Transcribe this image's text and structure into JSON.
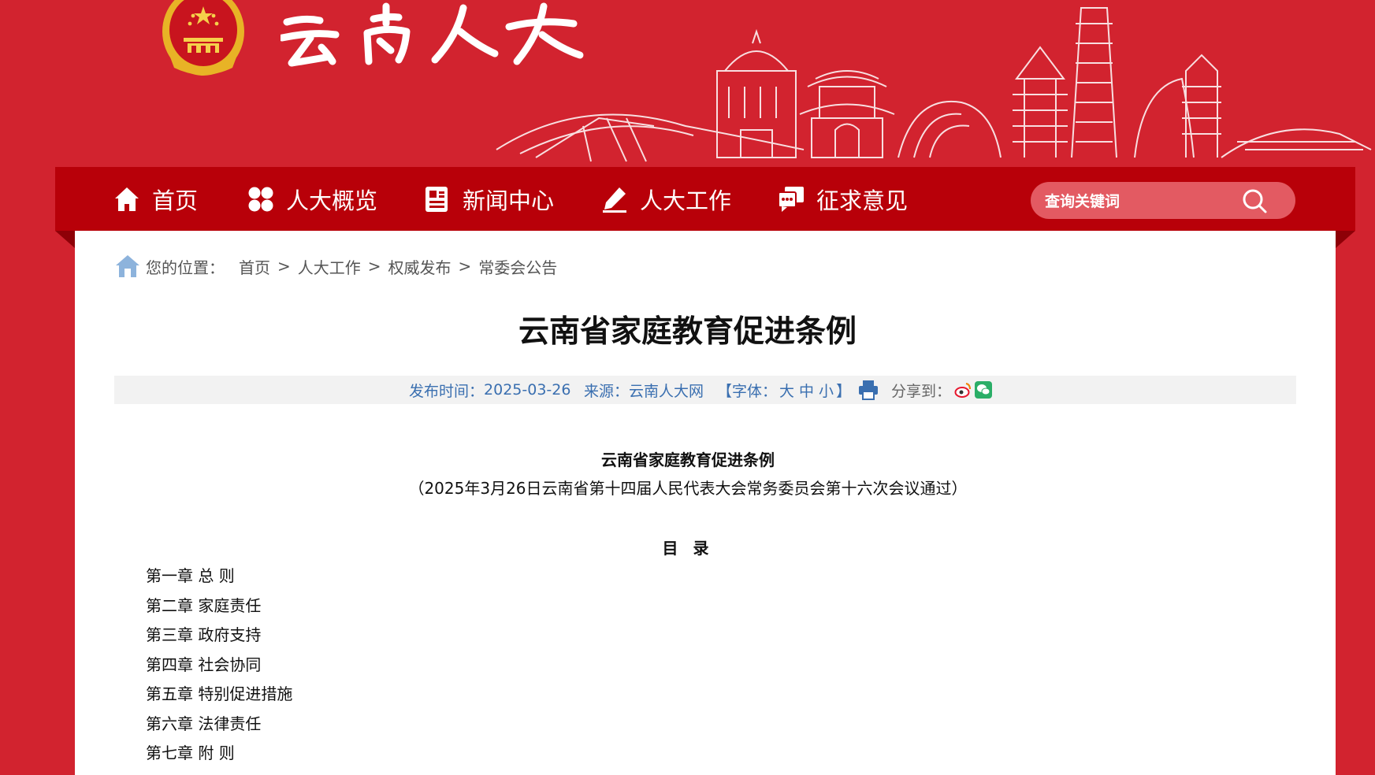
{
  "colors": {
    "banner_red": "#d2232f",
    "nav_red": "#b80009",
    "meta_blue": "#3a6fb0",
    "emblem_gold": "#f2c230"
  },
  "header": {
    "site_logo_text": "云南人大",
    "emblem": "national-emblem"
  },
  "nav": {
    "items": [
      {
        "label": "首页",
        "icon": "home-icon"
      },
      {
        "label": "人大概览",
        "icon": "grid-icon"
      },
      {
        "label": "新闻中心",
        "icon": "news-icon"
      },
      {
        "label": "人大工作",
        "icon": "pencil-icon"
      },
      {
        "label": "征求意见",
        "icon": "chat-icon"
      }
    ],
    "search_placeholder": "查询关键词",
    "search_icon": "search-icon"
  },
  "breadcrumb": {
    "label": "您的位置：",
    "items": [
      "首页",
      "人大工作",
      "权威发布",
      "常委会公告"
    ],
    "separator": ">"
  },
  "article": {
    "title": "云南省家庭教育促进条例",
    "meta": {
      "date_label": "发布时间：",
      "date": "2025-03-26",
      "source_label": "来源：",
      "source": "云南人大网",
      "font_open": "【字体：",
      "font_large": "大",
      "font_medium": "中",
      "font_small": "小",
      "font_close": "】",
      "share_label": "分享到："
    },
    "doc_title": "云南省家庭教育促进条例",
    "doc_subtitle": "（2025年3月26日云南省第十四届人民代表大会常务委员会第十六次会议通过）",
    "toc_heading": "目 录",
    "toc": [
      "第一章 总 则",
      "第二章 家庭责任",
      "第三章 政府支持",
      "第四章 社会协同",
      "第五章 特别促进措施",
      "第六章 法律责任",
      "第七章 附 则"
    ]
  }
}
